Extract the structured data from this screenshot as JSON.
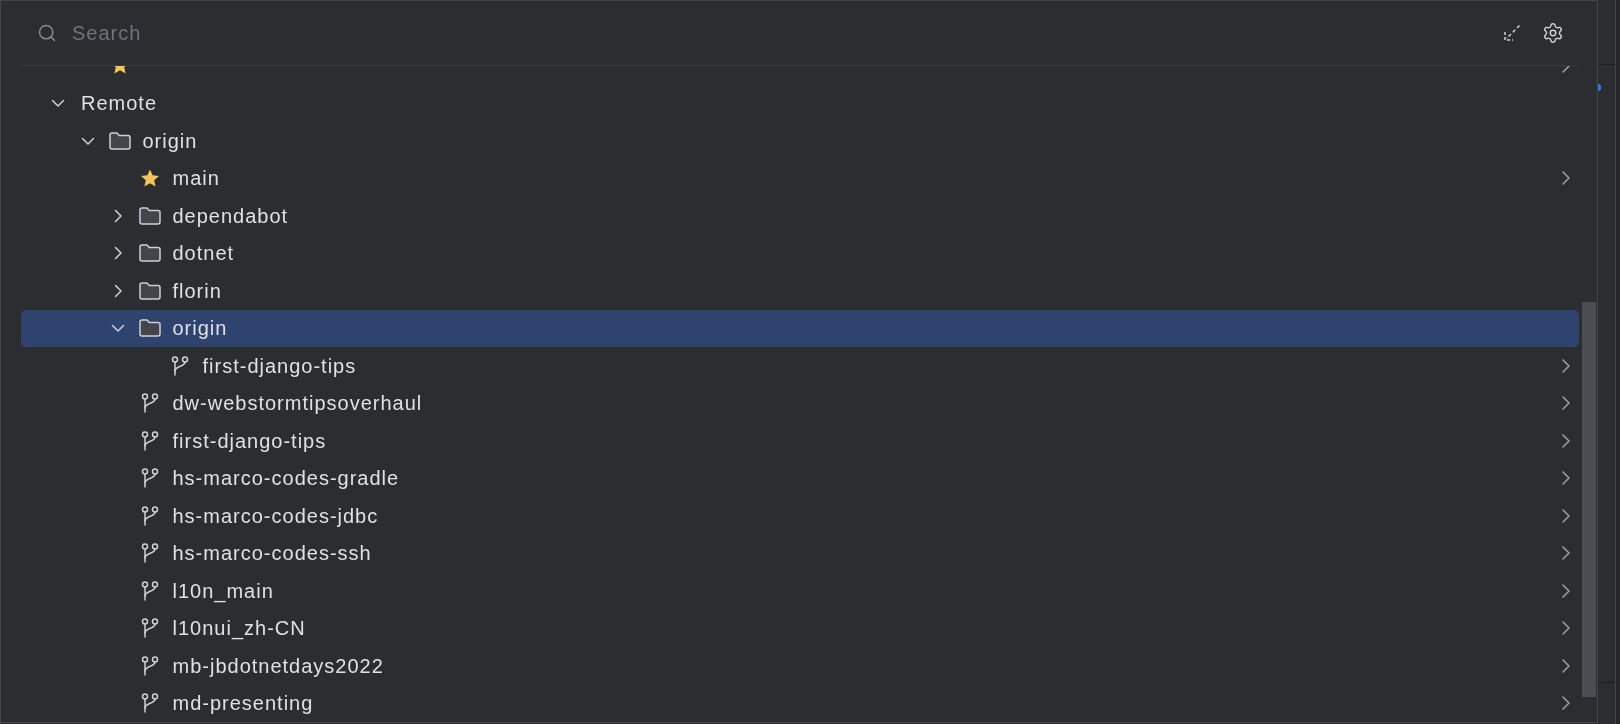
{
  "search": {
    "placeholder": "Search"
  },
  "tree": {
    "clipped_top_row": {
      "kind": "favorite",
      "selected": false
    },
    "nodes": [
      {
        "kind": "group",
        "label": "Remote",
        "expanded": true,
        "selected": false,
        "children": [
          {
            "kind": "folder",
            "label": "origin",
            "expanded": true,
            "selected": false,
            "children": [
              {
                "kind": "favorite",
                "label": "main",
                "selected": false
              },
              {
                "kind": "folder",
                "label": "dependabot",
                "expanded": false,
                "selected": false
              },
              {
                "kind": "folder",
                "label": "dotnet",
                "expanded": false,
                "selected": false
              },
              {
                "kind": "folder",
                "label": "florin",
                "expanded": false,
                "selected": false
              },
              {
                "kind": "folder",
                "label": "origin",
                "expanded": true,
                "selected": true,
                "children": [
                  {
                    "kind": "branch",
                    "label": "first-django-tips",
                    "selected": false
                  }
                ]
              },
              {
                "kind": "branch",
                "label": "dw-webstormtipsoverhaul",
                "selected": false
              },
              {
                "kind": "branch",
                "label": "first-django-tips",
                "selected": false
              },
              {
                "kind": "branch",
                "label": "hs-marco-codes-gradle",
                "selected": false
              },
              {
                "kind": "branch",
                "label": "hs-marco-codes-jdbc",
                "selected": false
              },
              {
                "kind": "branch",
                "label": "hs-marco-codes-ssh",
                "selected": false
              },
              {
                "kind": "branch",
                "label": "l10n_main",
                "selected": false
              },
              {
                "kind": "branch",
                "label": "l10nui_zh-CN",
                "selected": false
              },
              {
                "kind": "branch",
                "label": "mb-jbdotnetdays2022",
                "selected": false
              },
              {
                "kind": "branch",
                "label": "md-presenting",
                "selected": false
              }
            ]
          }
        ]
      }
    ]
  }
}
